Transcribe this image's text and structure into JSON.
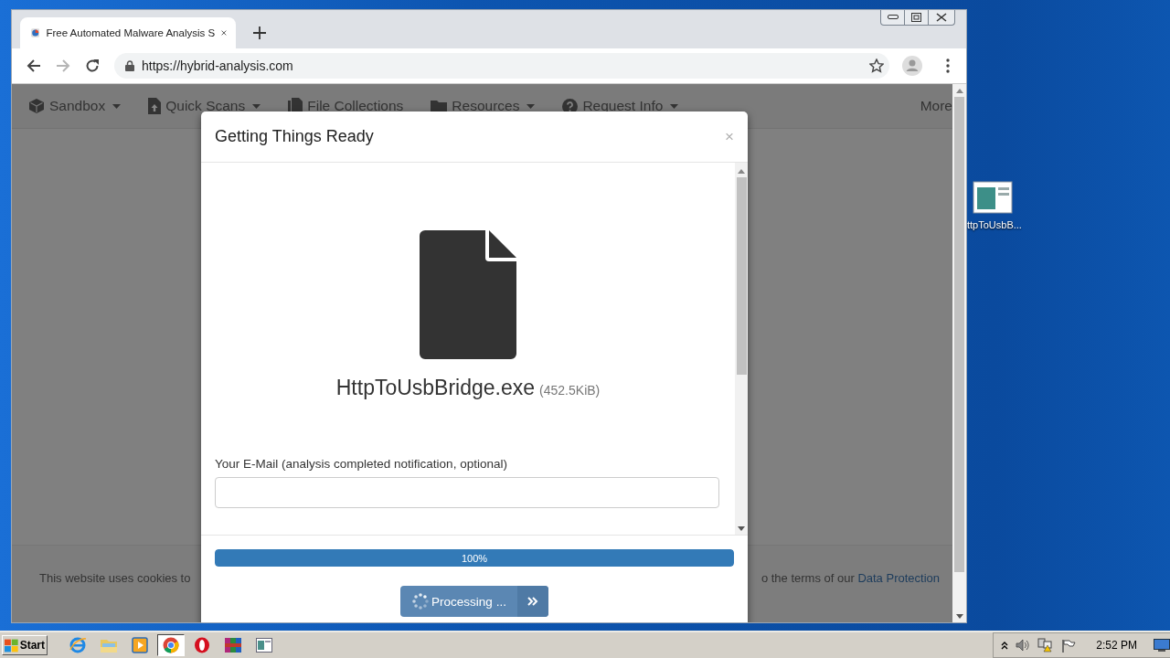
{
  "browser": {
    "tab": {
      "title": "Free Automated Malware Analysis S",
      "selected": true
    },
    "address": "https://hybrid-analysis.com",
    "forward_disabled": true
  },
  "nav": [
    {
      "label": "Sandbox",
      "kind": "cube",
      "dropdown": true
    },
    {
      "label": "Quick Scans",
      "kind": "upload",
      "dropdown": true
    },
    {
      "label": "File Collections",
      "kind": "files",
      "dropdown": false
    },
    {
      "label": "Resources",
      "kind": "folder",
      "dropdown": true
    },
    {
      "label": "Request Info",
      "kind": "question",
      "dropdown": true
    },
    {
      "label": "More",
      "kind": "none",
      "dropdown": false
    }
  ],
  "cookie_notice": {
    "text_start": "This website uses cookies to",
    "text_end": "o the terms of our",
    "link": "Data Protection"
  },
  "modal": {
    "title": "Getting Things Ready",
    "close": "×",
    "file": {
      "name": "HttpToUsbBridge.exe",
      "size": "(452.5KiB)"
    },
    "email_label": "Your E-Mail (analysis completed notification, optional)",
    "progress": {
      "level": 1,
      "label": "100%"
    },
    "submit": {
      "label": "Processing ..."
    }
  },
  "desktop_icons": [
    {
      "label": "ttpToUsbB..."
    }
  ],
  "taskbar": {
    "start": "Start",
    "apps": [
      {
        "kind": "ie",
        "selected": false
      },
      {
        "kind": "explorer",
        "selected": false
      },
      {
        "kind": "media",
        "selected": false
      },
      {
        "kind": "chrome",
        "selected": true
      },
      {
        "kind": "opera",
        "selected": false
      },
      {
        "kind": "winrar",
        "selected": false
      },
      {
        "kind": "window",
        "selected": false
      }
    ],
    "clock": "2:52 PM"
  }
}
